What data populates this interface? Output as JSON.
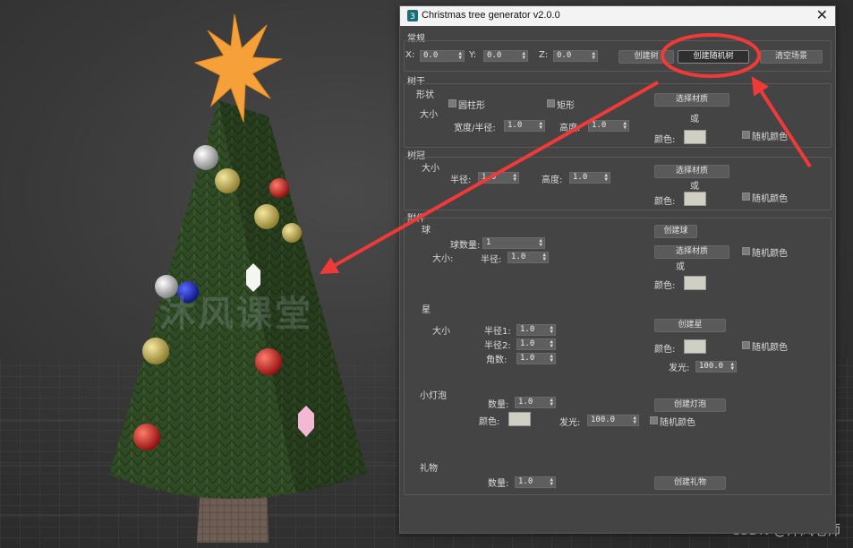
{
  "watermark": "沐风课堂",
  "credit": "CSDN @沐风老师",
  "dialog": {
    "title": "Christmas tree generator v2.0.0",
    "close": "✕",
    "general": {
      "label": "常规",
      "x_label": "X:",
      "x_value": "0.0",
      "y_label": "Y:",
      "y_value": "0.0",
      "z_label": "Z:",
      "z_value": "0.0",
      "create_tree": "创建树",
      "create_random_tree": "创建随机树",
      "clear_scene": "清空场景"
    },
    "trunk": {
      "label": "树干",
      "shape_label": "形状",
      "cylinder": "圆柱形",
      "rectangle": "矩形",
      "size_label": "大小",
      "width_label": "宽度/半径:",
      "width_value": "1.0",
      "height_label": "高度:",
      "height_value": "1.0",
      "select_material": "选择材质",
      "or": "或",
      "color_label": "颜色:",
      "random_color": "随机颜色"
    },
    "crown": {
      "label": "树冠",
      "size_label": "大小",
      "radius_label": "半径:",
      "radius_value": "1.0",
      "height_label": "高度:",
      "height_value": "1.0",
      "select_material": "选择材质",
      "or": "或",
      "color_label": "颜色:",
      "random_color": "随机颜色"
    },
    "decor": {
      "label": "附件",
      "ball": {
        "label": "球",
        "count_label": "球数量:",
        "count_value": "1",
        "size_label": "大小:",
        "radius_label": "半径:",
        "radius_value": "1.0",
        "create": "创建球",
        "select_material": "选择材质",
        "or": "或",
        "color_label": "颜色:",
        "random_color": "随机颜色"
      },
      "star": {
        "label": "星",
        "size_label": "大小",
        "radius1_label": "半径1:",
        "radius1_value": "1.0",
        "radius2_label": "半径2:",
        "radius2_value": "1.0",
        "points_label": "角数:",
        "points_value": "1.0",
        "create": "创建星",
        "color_label": "颜色:",
        "random_color": "随机颜色",
        "glow_label": "发光:",
        "glow_value": "100.0"
      },
      "bulb": {
        "label": "小灯泡",
        "count_label": "数量:",
        "count_value": "1.0",
        "color_label": "颜色:",
        "glow_label": "发光:",
        "glow_value": "100.0",
        "create": "创建灯泡",
        "random_color": "随机颜色"
      },
      "gift": {
        "label": "礼物",
        "count_label": "数量:",
        "count_value": "1.0",
        "create": "创建礼物"
      }
    }
  },
  "colors": {
    "annotation": "#f03a3a",
    "swatch": "#cfcfc3",
    "star": "#f6a03a",
    "tree": "#2e4a22"
  }
}
